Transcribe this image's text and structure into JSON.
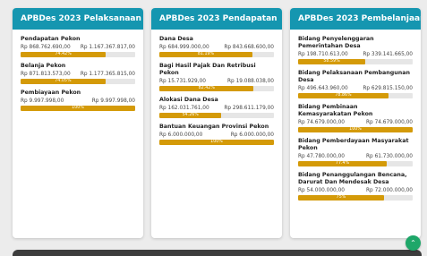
{
  "cards": [
    {
      "title": "APBDes 2023 Pelaksanaan",
      "items": [
        {
          "title": "Pendapatan Pekon",
          "left": "Rp 868.762.690,00",
          "right": "Rp 1.167.367.817,00",
          "pct_label": "74.42%",
          "pct": 74.42
        },
        {
          "title": "Belanja Pekon",
          "left": "Rp 871.813.573,00",
          "right": "Rp 1.177.365.815,00",
          "pct_label": "74.05%",
          "pct": 74.05
        },
        {
          "title": "Pembiayaan Pekon",
          "left": "Rp 9.997.998,00",
          "right": "Rp 9.997.998,00",
          "pct_label": "100%",
          "pct": 100
        }
      ]
    },
    {
      "title": "APBDes 2023 Pendapatan",
      "items": [
        {
          "title": "Dana Desa",
          "left": "Rp 684.999.000,00",
          "right": "Rp 843.668.600,00",
          "pct_label": "81.19%",
          "pct": 81.19
        },
        {
          "title": "Bagi Hasil Pajak Dan Retribusi Pekon",
          "left": "Rp 15.731.929,00",
          "right": "Rp 19.088.038,00",
          "pct_label": "82.42%",
          "pct": 82.42
        },
        {
          "title": "Alokasi Dana Desa",
          "left": "Rp 162.031.761,00",
          "right": "Rp 298.611.179,00",
          "pct_label": "54.26%",
          "pct": 54.26
        },
        {
          "title": "Bantuan Keuangan Provinsi Pekon",
          "left": "Rp 6.000.000,00",
          "right": "Rp 6.000.000,00",
          "pct_label": "100%",
          "pct": 100
        }
      ]
    },
    {
      "title": "APBDes 2023 Pembelanjaan",
      "items": [
        {
          "title": "Bidang Penyelenggaran Pemerintahan Desa",
          "left": "Rp 198.710.613,00",
          "right": "Rp 339.141.665,00",
          "pct_label": "58.59%",
          "pct": 58.59
        },
        {
          "title": "Bidang Pelaksanaan Pembangunan Desa",
          "left": "Rp 496.643.960,00",
          "right": "Rp 629.815.150,00",
          "pct_label": "78.86%",
          "pct": 78.86
        },
        {
          "title": "Bidang Pembinaan Kemasyarakatan Pekon",
          "left": "Rp 74.679.000,00",
          "right": "Rp 74.679.000,00",
          "pct_label": "100%",
          "pct": 100
        },
        {
          "title": "Bidang Pemberdayaan Masyarakat Pekon",
          "left": "Rp 47.780.000,00",
          "right": "Rp 61.730.000,00",
          "pct_label": "77.4%",
          "pct": 77.4
        },
        {
          "title": "Bidang Penanggulangan Bencana, Darurat Dan Mendesak Desa",
          "left": "Rp 54.000.000,00",
          "right": "Rp 72.000.000,00",
          "pct_label": "75%",
          "pct": 75
        }
      ]
    }
  ],
  "icons": {
    "scroll_top": "chevron-up-icon"
  },
  "colors": {
    "header": "#1596b0",
    "bar_fill": "#d49a08",
    "bar_track": "#e6e6e6",
    "fab": "#1ea769"
  }
}
